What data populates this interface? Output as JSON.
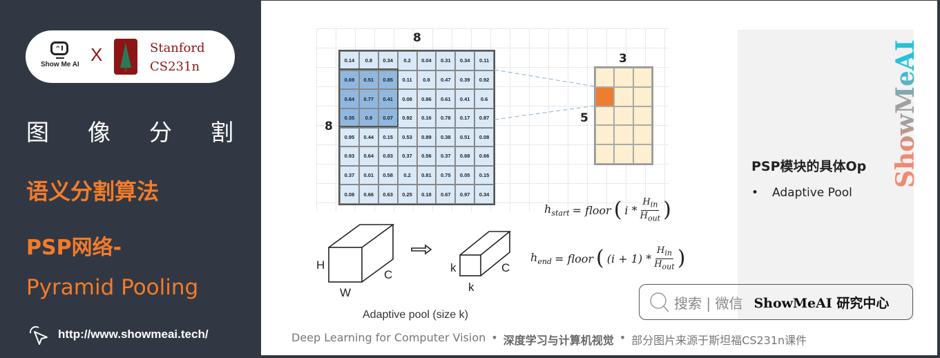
{
  "sidebar": {
    "logo": {
      "showmeai_text": "Show Me AI",
      "x_mark": "X",
      "stanford_line1": "Stanford",
      "stanford_line2": "CS231n"
    },
    "title_chars": [
      "图",
      "像",
      "分",
      "割"
    ],
    "subtitle1": "语义分割算法",
    "subtitle2": "PSP网络-",
    "subtitle3": "Pyramid Pooling",
    "link": "http://www.showmeai.tech/"
  },
  "figure": {
    "input_width_label": "8",
    "input_height_label": "8",
    "output_width_label": "3",
    "output_height_label": "5",
    "matrix": [
      [
        "0.14",
        "0.8",
        "0.34",
        "0.2",
        "0.04",
        "0.31",
        "0.34",
        "0.11"
      ],
      [
        "0.69",
        "0.51",
        "0.85",
        "0.11",
        "0.8",
        "0.47",
        "0.39",
        "0.92"
      ],
      [
        "0.64",
        "0.77",
        "0.41",
        "0.08",
        "0.86",
        "0.61",
        "0.41",
        "0.6"
      ],
      [
        "0.35",
        "0.9",
        "0.07",
        "0.92",
        "0.16",
        "0.78",
        "0.17",
        "0.87"
      ],
      [
        "0.95",
        "0.44",
        "0.15",
        "0.53",
        "0.89",
        "0.38",
        "0.51",
        "0.08"
      ],
      [
        "0.93",
        "0.64",
        "0.83",
        "0.37",
        "0.56",
        "0.37",
        "0.68",
        "0.66"
      ],
      [
        "0.37",
        "0.01",
        "0.58",
        "0.2",
        "0.81",
        "0.75",
        "0.05",
        "0.15"
      ],
      [
        "0.08",
        "0.66",
        "0.63",
        "0.25",
        "0.18",
        "0.67",
        "0.97",
        "0.34"
      ]
    ],
    "highlight_rows": [
      1,
      2,
      3
    ],
    "highlight_cols": [
      0,
      1,
      2
    ],
    "output_highlight": {
      "row": 1,
      "col": 0
    },
    "colors": {
      "input_cell": "#d9e9f7",
      "input_highlight": "#8fb8e0",
      "output_cell": "#fdefcf",
      "output_highlight": "#ed7d31"
    },
    "cube_labels": {
      "H": "H",
      "W": "W",
      "C1": "C",
      "k1": "k",
      "k2": "k",
      "C2": "C"
    },
    "caption": "Adaptive pool (size k)",
    "formula_start": {
      "lhs": "h",
      "lhs_sub": "start",
      "func": "= floor",
      "arg": "i *",
      "num": "H",
      "num_sub": "in",
      "den": "H",
      "den_sub": "out"
    },
    "formula_end": {
      "lhs": "h",
      "lhs_sub": "end",
      "func": "= floor",
      "arg": "(i + 1) *",
      "num": "H",
      "num_sub": "in",
      "den": "H",
      "den_sub": "out"
    }
  },
  "panel": {
    "title": "PSP模块的具体Op",
    "bullet": "•",
    "bullet_text": "Adaptive Pool",
    "watermark": "ShowMeAI"
  },
  "search": {
    "hint": "搜索 | 微信",
    "brand": "ShowMeAI 研究中心"
  },
  "footer": {
    "part1": "Deep Learning for Computer Vision",
    "sep": "•",
    "part2": "深度学习与计算机视觉",
    "part3": "部分图片来源于斯坦福CS231n课件"
  }
}
